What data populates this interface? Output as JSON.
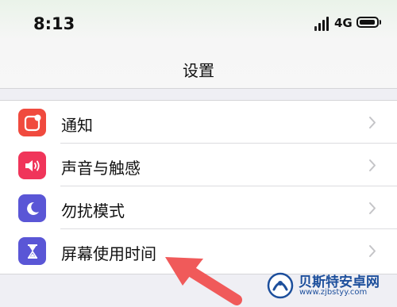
{
  "status_bar": {
    "time": "8:13",
    "network": "4G"
  },
  "nav": {
    "title": "设置"
  },
  "settings": [
    {
      "label": "通知",
      "icon": "notifications-icon",
      "color": "#f04a3e"
    },
    {
      "label": "声音与触感",
      "icon": "sound-icon",
      "color": "#f0355a"
    },
    {
      "label": "勿扰模式",
      "icon": "moon-icon",
      "color": "#5a56d6"
    },
    {
      "label": "屏幕使用时间",
      "icon": "hourglass-icon",
      "color": "#5a56d6"
    }
  ],
  "watermark": {
    "name": "贝斯特安卓网",
    "url": "www.zjbstyy.com"
  },
  "colors": {
    "annotation_arrow": "#f05a5a",
    "watermark": "#1d4f9c"
  }
}
